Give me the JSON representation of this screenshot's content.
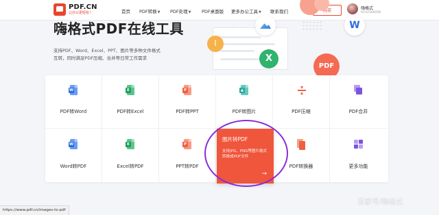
{
  "header": {
    "logo_name": "PDF.CN",
    "logo_tagline": "让办公更轻松！",
    "nav": [
      {
        "label": "首页",
        "dropdown": false
      },
      {
        "label": "PDF转换",
        "dropdown": true
      },
      {
        "label": "PDF处理",
        "dropdown": true
      },
      {
        "label": "PDF桌面版",
        "dropdown": false
      },
      {
        "label": "更多办公工具",
        "dropdown": true
      },
      {
        "label": "联系我们",
        "dropdown": false
      }
    ],
    "login_label": "购买",
    "user_name": "嗨格式",
    "user_id": "ID:42169206"
  },
  "hero": {
    "title": "嗨格式PDF在线工具",
    "desc_line1": "支持PDF、Word、Excel、PPT、图片等多种文件格式",
    "desc_line2": "互转，同时满足PDF压缩、合并等日常工作需求"
  },
  "illustration": {
    "excel_letter": "X",
    "word_letter": "W",
    "pdf_text": "PDF"
  },
  "tools": {
    "row1": [
      {
        "label": "PDF转Word",
        "icon": "word-doc-icon",
        "color": "blue",
        "badge": "W"
      },
      {
        "label": "PDF转Excel",
        "icon": "excel-doc-icon",
        "color": "green",
        "badge": "E"
      },
      {
        "label": "PDF转PPT",
        "icon": "ppt-doc-icon",
        "color": "red",
        "badge": "P"
      },
      {
        "label": "PDF转图片",
        "icon": "image-doc-icon",
        "color": "teal",
        "badge": "▲"
      },
      {
        "label": "PDF压缩",
        "icon": "compress-icon"
      },
      {
        "label": "PDF合并",
        "icon": "merge-icon"
      }
    ],
    "row2": [
      {
        "label": "Word转PDF",
        "icon": "word-doc-icon",
        "color": "blue",
        "badge": "W"
      },
      {
        "label": "Excel转PDF",
        "icon": "excel-doc-icon",
        "color": "green",
        "badge": "E"
      },
      {
        "label": "PPT转PDF",
        "icon": "ppt-doc-icon",
        "color": "red",
        "badge": "P"
      },
      {
        "label": "图片转PDF",
        "featured": true
      },
      {
        "label": "PDF转换器",
        "icon": "converter-icon"
      },
      {
        "label": "更多功能",
        "icon": "grid-icon"
      }
    ],
    "featured": {
      "title": "图片转PDF",
      "desc": "支持JPG、PNG等图片格式转换成PDF文件",
      "arrow": "→"
    }
  },
  "status_url": "https://www.pdf.cn/images-to-pdf",
  "watermark": "百家号/嗨格式",
  "colors": {
    "brand": "#e8452e",
    "featured": "#f0563c",
    "highlight_ring": "#8a2ad9"
  }
}
